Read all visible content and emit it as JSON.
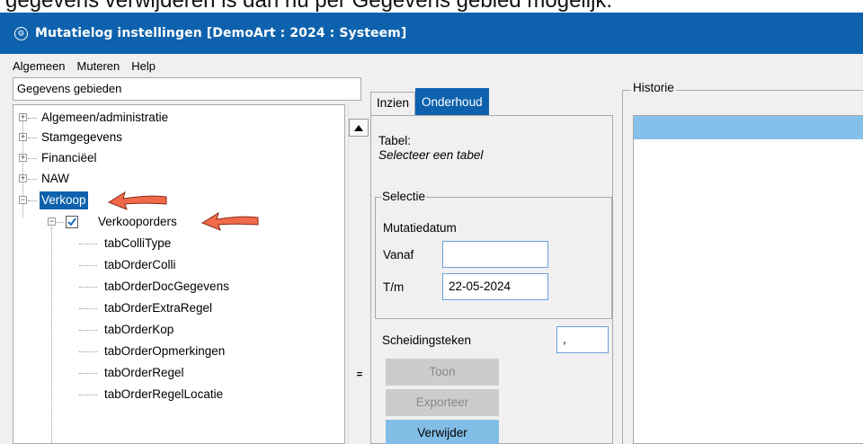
{
  "caption": "gegevens verwijderen is dan nu per Gegevens gebied mogelijk.",
  "window": {
    "title": "Mutatielog instellingen  [DemoArt : 2024 : Systeem]"
  },
  "menu": [
    "Algemeen",
    "Muteren",
    "Help"
  ],
  "left_panel": {
    "header": "Gegevens gebieden",
    "tree": [
      {
        "label": "Algemeen/administratie"
      },
      {
        "label": "Stamgegevens"
      },
      {
        "label": "Financiëel"
      },
      {
        "label": "NAW"
      },
      {
        "label": "Verkoop"
      },
      {
        "label": "Verkooporders"
      },
      {
        "label": "tabColliType"
      },
      {
        "label": "tabOrderColli"
      },
      {
        "label": "tabOrderDocGegevens"
      },
      {
        "label": "tabOrderExtraRegel"
      },
      {
        "label": "tabOrderKop"
      },
      {
        "label": "tabOrderOpmerkingen"
      },
      {
        "label": "tabOrderRegel"
      },
      {
        "label": "tabOrderRegelLocatie"
      }
    ]
  },
  "middle_panel": {
    "tabs": [
      "Inzien",
      "Onderhoud"
    ],
    "active_tab": "Onderhoud",
    "tabel_label": "Tabel:",
    "tabel_value": "Selecteer een tabel",
    "selectie": {
      "title": "Selectie",
      "mutatiedatum_label": "Mutatiedatum",
      "vanaf_label": "Vanaf",
      "vanaf_value": "",
      "tm_label": "T/m",
      "tm_value": "22-05-2024"
    },
    "scheidingsteken_label": "Scheidingsteken",
    "scheidingsteken_value": ",",
    "buttons": {
      "toon": "Toon",
      "exporteer": "Exporteer",
      "verwijder": "Verwijder"
    }
  },
  "right_panel": {
    "title": "Historie"
  },
  "colors": {
    "titlebar": "#0e62ad",
    "selection": "#0e62ad",
    "primary_button": "#82bde6",
    "arrow": "#f06a4a"
  },
  "icons": [
    "app-icon",
    "expand-icon",
    "collapse-icon",
    "checkbox-checked-icon",
    "scroll-up-icon",
    "pointer-arrow-icon"
  ]
}
